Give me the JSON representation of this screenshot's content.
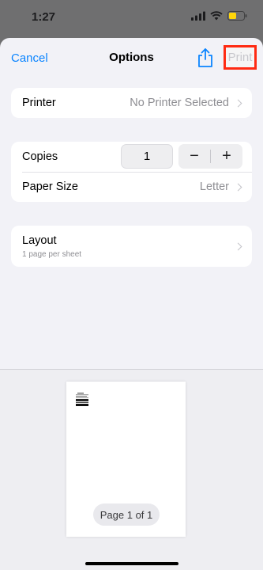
{
  "status_bar": {
    "time": "1:27"
  },
  "nav": {
    "cancel_label": "Cancel",
    "title": "Options",
    "print_label": "Print"
  },
  "printer": {
    "label": "Printer",
    "value": "No Printer Selected"
  },
  "copies": {
    "label": "Copies",
    "value": "1",
    "minus": "−",
    "plus": "+"
  },
  "paper": {
    "label": "Paper Size",
    "value": "Letter"
  },
  "layout": {
    "label": "Layout",
    "sub": "1 page per sheet"
  },
  "preview": {
    "page_label": "Page 1 of 1"
  },
  "colors": {
    "accent": "#0a84ff",
    "highlight": "#ff2a12",
    "disabled": "#c7c7cc"
  }
}
